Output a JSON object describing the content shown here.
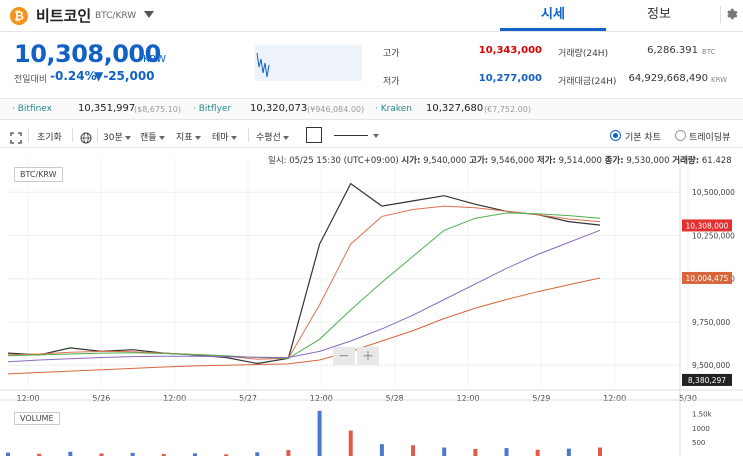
{
  "header": {
    "coin_name": "비트코인",
    "pair": "BTC/KRW",
    "tabs": [
      {
        "label": "시세"
      },
      {
        "label": "정보"
      }
    ],
    "icons": {
      "logo": "bitcoin-logo-icon",
      "dropdown": "chevron-down-icon",
      "settings": "gear-icon"
    },
    "logo_glyph": "₿"
  },
  "price": {
    "current": "10,308,000",
    "unit": "KRW",
    "change_label": "전일대비",
    "change_pct": "-0.24%",
    "change_amt": "▼-25,000"
  },
  "stats": {
    "high_label": "고가",
    "high_value": "10,343,000",
    "low_label": "저가",
    "low_value": "10,277,000",
    "volume_label": "거래량(24H)",
    "volume_value": "6,286.391",
    "volume_unit": "BTC",
    "amount_label": "거래대금(24H)",
    "amount_value": "64,929,668,490",
    "amount_unit": "KRW"
  },
  "exchanges": [
    {
      "name": "· Bitfinex",
      "price": "10,351,997",
      "sub": "($8,675.10)"
    },
    {
      "name": "· Bitflyer",
      "price": "10,320,073",
      "sub": "(¥946,084.00)"
    },
    {
      "name": "· Kraken",
      "price": "10,327,680",
      "sub": "(€7,752.00)"
    }
  ],
  "toolbar": {
    "reset": "초기화",
    "interval": "30분",
    "candle": "캔들",
    "indicator": "지표",
    "theme": "테마",
    "horizontal_line": "수평선",
    "basic_chart": "기본 차트",
    "tradingview": "트레이딩뷰",
    "colors": {
      "accent": "#1261c4"
    }
  },
  "ohlc": {
    "date_label": "일시:",
    "date": "05/25 15:30 (UTC+09:00)",
    "open_label": "시가:",
    "open": "9,540,000",
    "high_label": "고가:",
    "high": "9,546,000",
    "low_label": "저가:",
    "low": "9,514,000",
    "close_label": "종가:",
    "close": "9,530,000",
    "volume_label": "거래량:",
    "volume": "61.428"
  },
  "chart_data": {
    "type": "line",
    "pair_label": "BTC/KRW",
    "volume_label": "VOLUME",
    "y_ticks": [
      "10,500,000",
      "10,250,000",
      "10,000,000",
      "9,750,000",
      "9,500,000"
    ],
    "y_tick_values": [
      10500000,
      10250000,
      10000000,
      9750000,
      9500000
    ],
    "ylim": [
      9380000,
      10640000
    ],
    "price_tags": [
      {
        "label": "10,308,000",
        "value": 10308000,
        "color": "#e03030"
      },
      {
        "label": "10,004,475",
        "value": 10004475,
        "color": "#d9653b"
      },
      {
        "label": "8,380,297",
        "value": 9415000,
        "color": "#222222"
      }
    ],
    "x_ticks": [
      "12:00",
      "5/26",
      "12:00",
      "5/27",
      "12:00",
      "5/28",
      "12:00",
      "5/29",
      "12:00",
      "5/30"
    ],
    "volume_ticks": [
      "1.50k",
      "1000",
      "500"
    ],
    "volume_tick_values": [
      1500,
      1000,
      500
    ],
    "series": [
      {
        "color": "#333333",
        "values": [
          9570000,
          9560000,
          9600000,
          9580000,
          9590000,
          9570000,
          9560000,
          9545000,
          9510000,
          9540000,
          10200000,
          10550000,
          10420000,
          10450000,
          10480000,
          10430000,
          10390000,
          10370000,
          10330000,
          10310000
        ]
      },
      {
        "color": "#e07050",
        "values": [
          9560000,
          9565000,
          9575000,
          9580000,
          9578000,
          9570000,
          9562000,
          9552000,
          9535000,
          9540000,
          9850000,
          10200000,
          10360000,
          10400000,
          10420000,
          10410000,
          10390000,
          10370000,
          10345000,
          10330000
        ]
      },
      {
        "color": "#4caf50",
        "values": [
          9555000,
          9560000,
          9565000,
          9570000,
          9572000,
          9568000,
          9562000,
          9555000,
          9545000,
          9540000,
          9650000,
          9820000,
          9980000,
          10130000,
          10280000,
          10350000,
          10380000,
          10375000,
          10365000,
          10350000
        ]
      },
      {
        "color": "#8a6bbf",
        "values": [
          9520000,
          9530000,
          9538000,
          9545000,
          9550000,
          9552000,
          9552000,
          9550000,
          9546000,
          9545000,
          9580000,
          9640000,
          9710000,
          9790000,
          9880000,
          9970000,
          10060000,
          10140000,
          10210000,
          10280000
        ]
      },
      {
        "color": "#d9653b",
        "values": [
          9450000,
          9458000,
          9466000,
          9474000,
          9482000,
          9490000,
          9496000,
          9500000,
          9504000,
          9508000,
          9530000,
          9580000,
          9640000,
          9700000,
          9770000,
          9830000,
          9880000,
          9925000,
          9965000,
          10004475
        ]
      }
    ],
    "volume_values": [
      120,
      80,
      150,
      90,
      110,
      70,
      95,
      60,
      130,
      210,
      1600,
      900,
      420,
      380,
      300,
      250,
      280,
      220,
      260,
      300
    ],
    "grid": true
  }
}
